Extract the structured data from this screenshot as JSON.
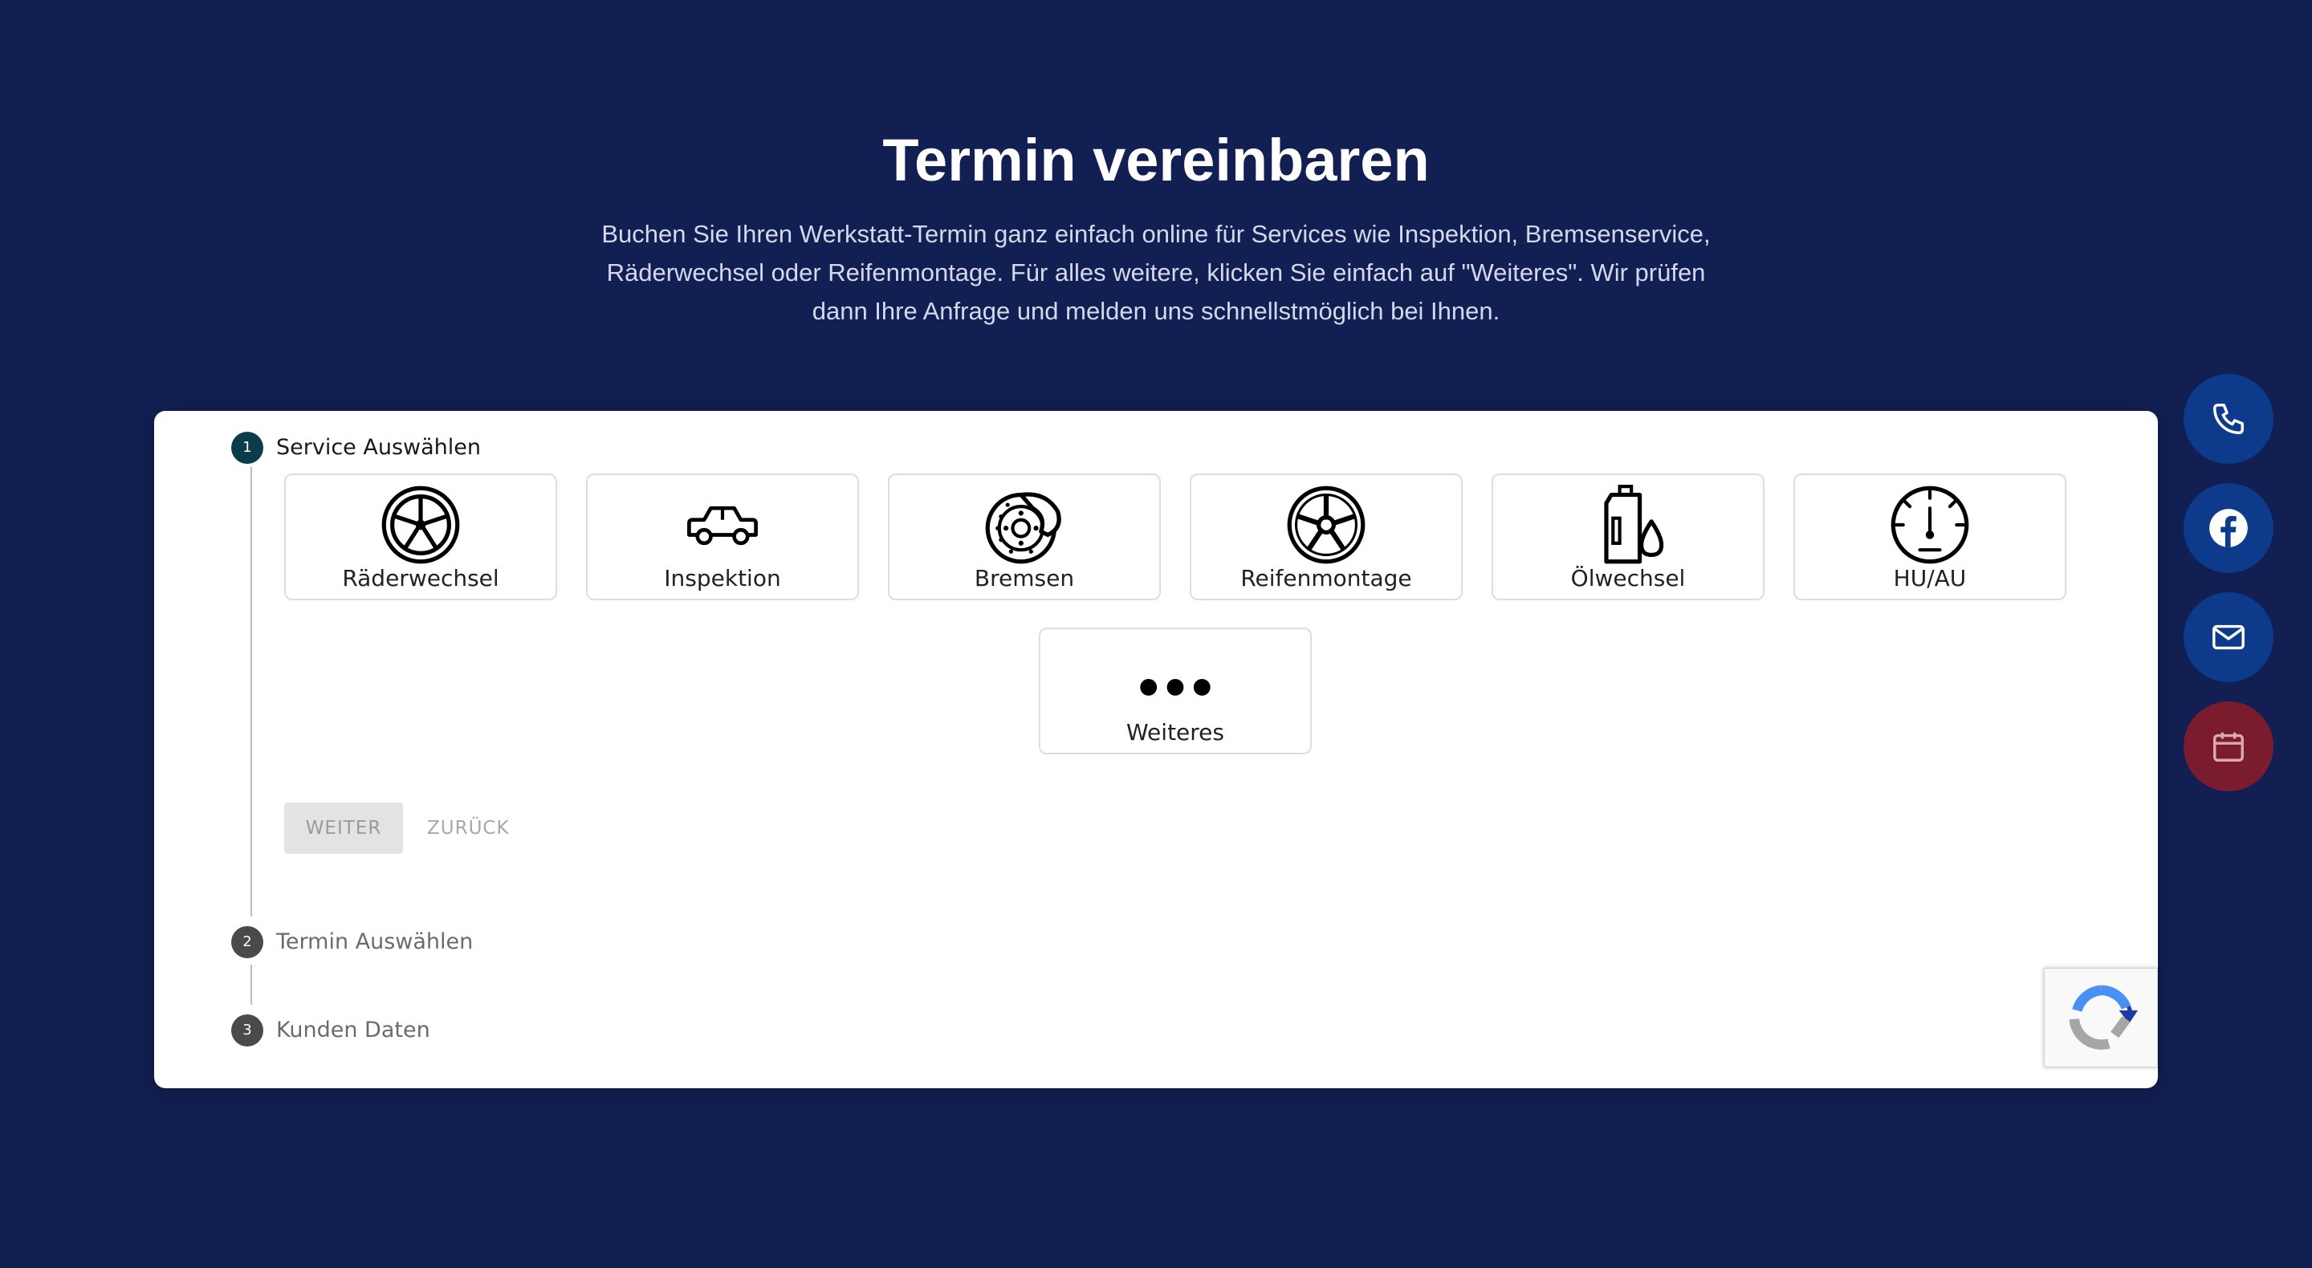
{
  "header": {
    "title": "Termin vereinbaren",
    "description": "Buchen Sie Ihren Werkstatt-Termin ganz einfach online für Services wie Inspektion, Bremsenservice, Räderwechsel oder Reifenmontage. Für alles weitere, klicken Sie einfach auf \"Weiteres\". Wir prüfen dann Ihre Anfrage und melden uns schnellstmöglich bei Ihnen."
  },
  "steps": [
    {
      "number": "1",
      "label": "Service Auswählen"
    },
    {
      "number": "2",
      "label": "Termin Auswählen"
    },
    {
      "number": "3",
      "label": "Kunden Daten"
    }
  ],
  "services": [
    {
      "label": "Räderwechsel",
      "icon": "wheel-icon"
    },
    {
      "label": "Inspektion",
      "icon": "car-icon"
    },
    {
      "label": "Bremsen",
      "icon": "brake-disc-icon"
    },
    {
      "label": "Reifenmontage",
      "icon": "rim-icon"
    },
    {
      "label": "Ölwechsel",
      "icon": "oil-can-icon"
    },
    {
      "label": "HU/AU",
      "icon": "gauge-icon"
    },
    {
      "label": "Weiteres",
      "icon": "more-dots-icon"
    }
  ],
  "buttons": {
    "next": "WEITER",
    "back": "ZURÜCK"
  },
  "colors": {
    "background": "#121f52",
    "active_step": "#0b3c4c",
    "inactive_step": "#4a4a4a",
    "fab_blue": "#0d3a8a",
    "fab_red": "#7a1c2e"
  },
  "floating_actions": [
    {
      "icon": "phone-icon"
    },
    {
      "icon": "facebook-icon"
    },
    {
      "icon": "mail-icon"
    },
    {
      "icon": "calendar-icon"
    }
  ]
}
